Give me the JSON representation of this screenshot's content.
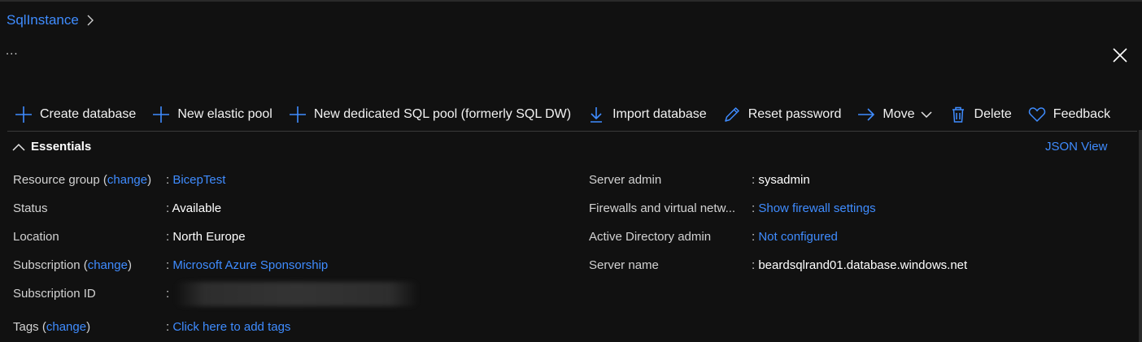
{
  "breadcrumb": {
    "item": "SqlInstance"
  },
  "header": {
    "ellipsis": "..."
  },
  "toolbar": {
    "create_database": "Create database",
    "new_elastic_pool": "New elastic pool",
    "new_dedicated_pool": "New dedicated SQL pool (formerly SQL DW)",
    "import_database": "Import database",
    "reset_password": "Reset password",
    "move": "Move",
    "delete": "Delete",
    "feedback": "Feedback"
  },
  "essentials": {
    "title": "Essentials",
    "json_view": "JSON View",
    "change": "change",
    "left": {
      "resource_group": {
        "label": "Resource group",
        "value": "BicepTest"
      },
      "status": {
        "label": "Status",
        "value": "Available"
      },
      "location": {
        "label": "Location",
        "value": "North Europe"
      },
      "subscription": {
        "label": "Subscription",
        "value": "Microsoft Azure Sponsorship"
      },
      "subscription_id": {
        "label": "Subscription ID",
        "value": ""
      },
      "tags": {
        "label": "Tags",
        "value": "Click here to add tags"
      }
    },
    "right": {
      "server_admin": {
        "label": "Server admin",
        "value": "sysadmin"
      },
      "firewalls": {
        "label": "Firewalls and virtual netw...",
        "value": "Show firewall settings"
      },
      "ad_admin": {
        "label": "Active Directory admin",
        "value": "Not configured"
      },
      "server_name": {
        "label": "Server name",
        "value": "beardsqlrand01.database.windows.net"
      }
    }
  },
  "colors": {
    "link": "#3f8cff",
    "background": "#111111",
    "text": "#ffffff"
  }
}
